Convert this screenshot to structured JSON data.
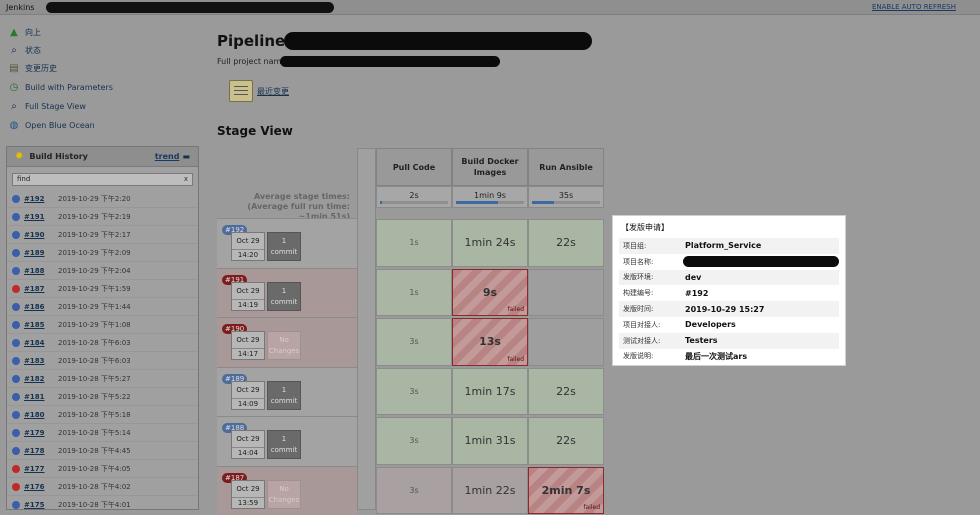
{
  "topbar": {
    "brand": "Jenkins",
    "auto_refresh": "ENABLE AUTO REFRESH"
  },
  "sidebar": {
    "tasks": [
      {
        "label": "向上",
        "icon": "up-arrow-icon"
      },
      {
        "label": "状态",
        "icon": "search-icon"
      },
      {
        "label": "变更历史",
        "icon": "notepad-icon"
      },
      {
        "label": "Build with Parameters",
        "icon": "clock-icon"
      },
      {
        "label": "Full Stage View",
        "icon": "search-icon"
      },
      {
        "label": "Open Blue Ocean",
        "icon": "globe-icon"
      }
    ],
    "build_history": {
      "title": "Build History",
      "trend": "trend",
      "find_value": "find",
      "clear": "x",
      "rows": [
        {
          "num": "#192",
          "date": "2019-10-29 下午2:20",
          "status": "blue"
        },
        {
          "num": "#191",
          "date": "2019-10-29 下午2:19",
          "status": "blue"
        },
        {
          "num": "#190",
          "date": "2019-10-29 下午2:17",
          "status": "blue"
        },
        {
          "num": "#189",
          "date": "2019-10-29 下午2:09",
          "status": "blue"
        },
        {
          "num": "#188",
          "date": "2019-10-29 下午2:04",
          "status": "blue"
        },
        {
          "num": "#187",
          "date": "2019-10-29 下午1:59",
          "status": "red"
        },
        {
          "num": "#186",
          "date": "2019-10-29 下午1:44",
          "status": "blue"
        },
        {
          "num": "#185",
          "date": "2019-10-29 下午1:08",
          "status": "blue"
        },
        {
          "num": "#184",
          "date": "2019-10-28 下午6:03",
          "status": "blue"
        },
        {
          "num": "#183",
          "date": "2019-10-28 下午6:03",
          "status": "blue"
        },
        {
          "num": "#182",
          "date": "2019-10-28 下午5:27",
          "status": "blue"
        },
        {
          "num": "#181",
          "date": "2019-10-28 下午5:22",
          "status": "blue"
        },
        {
          "num": "#180",
          "date": "2019-10-28 下午5:18",
          "status": "blue"
        },
        {
          "num": "#179",
          "date": "2019-10-28 下午5:14",
          "status": "blue"
        },
        {
          "num": "#178",
          "date": "2019-10-28 下午4:45",
          "status": "blue"
        },
        {
          "num": "#177",
          "date": "2019-10-28 下午4:05",
          "status": "red"
        },
        {
          "num": "#176",
          "date": "2019-10-28 下午4:02",
          "status": "red"
        },
        {
          "num": "#175",
          "date": "2019-10-28 下午4:01",
          "status": "blue"
        }
      ]
    }
  },
  "main": {
    "title": "Pipeline",
    "full_project_name": "Full project name:",
    "recent_changes": "最近变更",
    "stage_view": "Stage View",
    "avg_label": "Average stage times:\n(Average full run time: ~1min 51s)",
    "stages": [
      {
        "name": "Pull Code",
        "avg": "2s",
        "avg_pct": 0.03
      },
      {
        "name": "Build Docker Images",
        "avg": "1min 9s",
        "avg_pct": 0.62
      },
      {
        "name": "Run Ansible",
        "avg": "35s",
        "avg_pct": 0.32
      }
    ],
    "builds": [
      {
        "num": "#192",
        "badge": "blue",
        "month": "Oct 29",
        "time": "14:20",
        "changes": "1\ncommit",
        "cells": [
          "1s",
          "1min 24s",
          "22s"
        ],
        "states": [
          "ok",
          "ok",
          "ok"
        ]
      },
      {
        "num": "#191",
        "badge": "red",
        "month": "Oct 29",
        "time": "14:19",
        "changes": "1\ncommit",
        "cells": [
          "1s",
          "9s",
          ""
        ],
        "states": [
          "ok",
          "fail",
          "grey"
        ]
      },
      {
        "num": "#190",
        "badge": "red",
        "month": "Oct 29",
        "time": "14:17",
        "changes": "No\nChanges",
        "cells": [
          "3s",
          "13s",
          ""
        ],
        "states": [
          "ok",
          "fail",
          "grey"
        ]
      },
      {
        "num": "#189",
        "badge": "blue",
        "month": "Oct 29",
        "time": "14:09",
        "changes": "1\ncommit",
        "cells": [
          "3s",
          "1min 17s",
          "22s"
        ],
        "states": [
          "ok",
          "ok",
          "ok"
        ]
      },
      {
        "num": "#188",
        "badge": "blue",
        "month": "Oct 29",
        "time": "14:04",
        "changes": "1\ncommit",
        "cells": [
          "3s",
          "1min 31s",
          "22s"
        ],
        "states": [
          "ok",
          "ok",
          "ok"
        ]
      },
      {
        "num": "#187",
        "badge": "red",
        "month": "Oct 29",
        "time": "13:59",
        "changes": "No\nChanges",
        "cells": [
          "3s",
          "1min 22s",
          "2min 7s"
        ],
        "states": [
          "greyb",
          "greyb",
          "fail"
        ]
      }
    ],
    "failed_tag": "failed"
  },
  "popup": {
    "title": "【发版申请】",
    "rows": [
      {
        "key": "项目组:",
        "value": "Platform_Service"
      },
      {
        "key": "项目名称:",
        "value": ""
      },
      {
        "key": "发版环境:",
        "value": "dev"
      },
      {
        "key": "构建编号:",
        "value": "#192"
      },
      {
        "key": "发版时间:",
        "value": "2019-10-29 15:27"
      },
      {
        "key": "项目对接人:",
        "value": "Developers"
      },
      {
        "key": "测试对接人:",
        "value": "Testers"
      },
      {
        "key": "发版说明:",
        "value": "最后一次测试ars"
      }
    ]
  },
  "colors": {
    "blue_ball": "#3a5fa8",
    "red_ball": "#c0292a",
    "popup_bg": "#ffffff"
  }
}
